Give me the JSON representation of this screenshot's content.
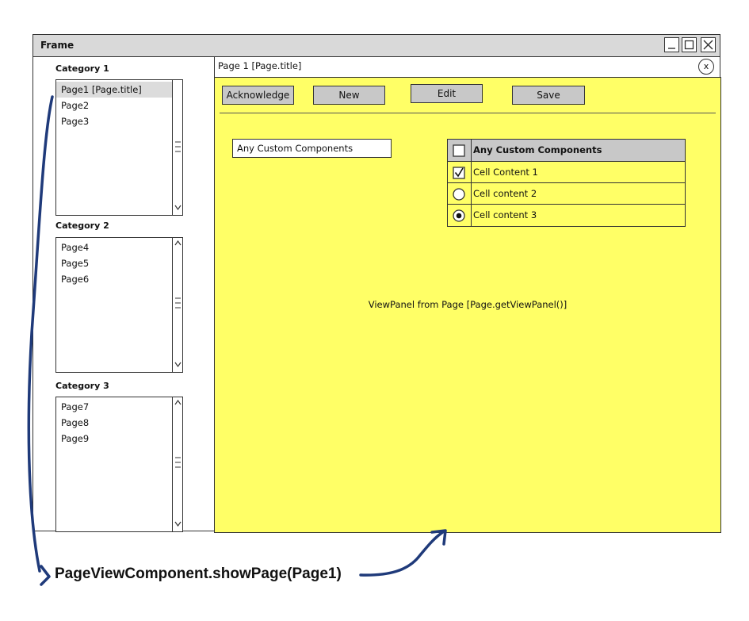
{
  "frame": {
    "title": "Frame",
    "window_buttons": [
      "minimize-icon",
      "maximize-icon",
      "close-icon"
    ]
  },
  "sidebar": {
    "categories": [
      {
        "label": "Category 1",
        "items": [
          "Page1 [Page.title]",
          "Page2",
          "Page3"
        ],
        "selected_index": 0
      },
      {
        "label": "Category 2",
        "items": [
          "Page4",
          "Page5",
          "Page6"
        ]
      },
      {
        "label": "Category 3",
        "items": [
          "Page7",
          "Page8",
          "Page9"
        ]
      }
    ]
  },
  "tab": {
    "title": "Page 1 [Page.title]",
    "close_glyph": "x"
  },
  "toolbar": {
    "acknowledge_label": "Acknowledge",
    "new_label": "New",
    "edit_label": "Edit",
    "save_label": "Save"
  },
  "custom_field": {
    "value": "Any Custom Components"
  },
  "grid": {
    "header": "Any Custom Components",
    "header_checked": false,
    "rows": [
      {
        "text": "Cell Content 1",
        "control": "checkbox",
        "checked": true
      },
      {
        "text": "Cell content 2",
        "control": "radio",
        "checked": false
      },
      {
        "text": "Cell content 3",
        "control": "radio",
        "checked": true
      }
    ]
  },
  "viewpanel": {
    "label": "ViewPanel from Page [Page.getViewPanel()]",
    "background": "#ffff66"
  },
  "annotation": {
    "caption": "PageViewComponent.showPage(Page1)",
    "arrow_color": "#1f3a7a"
  }
}
